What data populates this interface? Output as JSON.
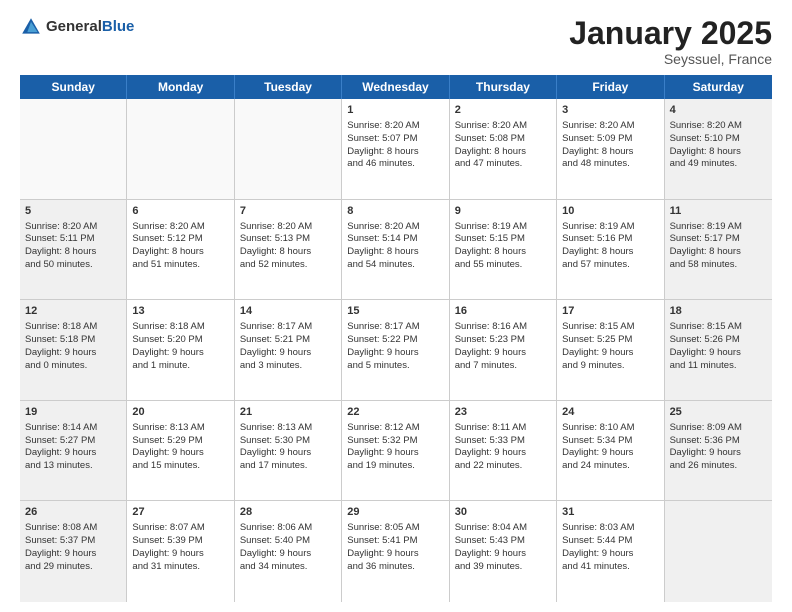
{
  "logo": {
    "general": "General",
    "blue": "Blue"
  },
  "header": {
    "month": "January 2025",
    "location": "Seyssuel, France"
  },
  "weekdays": [
    "Sunday",
    "Monday",
    "Tuesday",
    "Wednesday",
    "Thursday",
    "Friday",
    "Saturday"
  ],
  "weeks": [
    [
      {
        "day": "",
        "info": "",
        "shaded": false,
        "empty": true
      },
      {
        "day": "",
        "info": "",
        "shaded": false,
        "empty": true
      },
      {
        "day": "",
        "info": "",
        "shaded": false,
        "empty": true
      },
      {
        "day": "1",
        "info": "Sunrise: 8:20 AM\nSunset: 5:07 PM\nDaylight: 8 hours\nand 46 minutes.",
        "shaded": false,
        "empty": false
      },
      {
        "day": "2",
        "info": "Sunrise: 8:20 AM\nSunset: 5:08 PM\nDaylight: 8 hours\nand 47 minutes.",
        "shaded": false,
        "empty": false
      },
      {
        "day": "3",
        "info": "Sunrise: 8:20 AM\nSunset: 5:09 PM\nDaylight: 8 hours\nand 48 minutes.",
        "shaded": false,
        "empty": false
      },
      {
        "day": "4",
        "info": "Sunrise: 8:20 AM\nSunset: 5:10 PM\nDaylight: 8 hours\nand 49 minutes.",
        "shaded": true,
        "empty": false
      }
    ],
    [
      {
        "day": "5",
        "info": "Sunrise: 8:20 AM\nSunset: 5:11 PM\nDaylight: 8 hours\nand 50 minutes.",
        "shaded": true,
        "empty": false
      },
      {
        "day": "6",
        "info": "Sunrise: 8:20 AM\nSunset: 5:12 PM\nDaylight: 8 hours\nand 51 minutes.",
        "shaded": false,
        "empty": false
      },
      {
        "day": "7",
        "info": "Sunrise: 8:20 AM\nSunset: 5:13 PM\nDaylight: 8 hours\nand 52 minutes.",
        "shaded": false,
        "empty": false
      },
      {
        "day": "8",
        "info": "Sunrise: 8:20 AM\nSunset: 5:14 PM\nDaylight: 8 hours\nand 54 minutes.",
        "shaded": false,
        "empty": false
      },
      {
        "day": "9",
        "info": "Sunrise: 8:19 AM\nSunset: 5:15 PM\nDaylight: 8 hours\nand 55 minutes.",
        "shaded": false,
        "empty": false
      },
      {
        "day": "10",
        "info": "Sunrise: 8:19 AM\nSunset: 5:16 PM\nDaylight: 8 hours\nand 57 minutes.",
        "shaded": false,
        "empty": false
      },
      {
        "day": "11",
        "info": "Sunrise: 8:19 AM\nSunset: 5:17 PM\nDaylight: 8 hours\nand 58 minutes.",
        "shaded": true,
        "empty": false
      }
    ],
    [
      {
        "day": "12",
        "info": "Sunrise: 8:18 AM\nSunset: 5:18 PM\nDaylight: 9 hours\nand 0 minutes.",
        "shaded": true,
        "empty": false
      },
      {
        "day": "13",
        "info": "Sunrise: 8:18 AM\nSunset: 5:20 PM\nDaylight: 9 hours\nand 1 minute.",
        "shaded": false,
        "empty": false
      },
      {
        "day": "14",
        "info": "Sunrise: 8:17 AM\nSunset: 5:21 PM\nDaylight: 9 hours\nand 3 minutes.",
        "shaded": false,
        "empty": false
      },
      {
        "day": "15",
        "info": "Sunrise: 8:17 AM\nSunset: 5:22 PM\nDaylight: 9 hours\nand 5 minutes.",
        "shaded": false,
        "empty": false
      },
      {
        "day": "16",
        "info": "Sunrise: 8:16 AM\nSunset: 5:23 PM\nDaylight: 9 hours\nand 7 minutes.",
        "shaded": false,
        "empty": false
      },
      {
        "day": "17",
        "info": "Sunrise: 8:15 AM\nSunset: 5:25 PM\nDaylight: 9 hours\nand 9 minutes.",
        "shaded": false,
        "empty": false
      },
      {
        "day": "18",
        "info": "Sunrise: 8:15 AM\nSunset: 5:26 PM\nDaylight: 9 hours\nand 11 minutes.",
        "shaded": true,
        "empty": false
      }
    ],
    [
      {
        "day": "19",
        "info": "Sunrise: 8:14 AM\nSunset: 5:27 PM\nDaylight: 9 hours\nand 13 minutes.",
        "shaded": true,
        "empty": false
      },
      {
        "day": "20",
        "info": "Sunrise: 8:13 AM\nSunset: 5:29 PM\nDaylight: 9 hours\nand 15 minutes.",
        "shaded": false,
        "empty": false
      },
      {
        "day": "21",
        "info": "Sunrise: 8:13 AM\nSunset: 5:30 PM\nDaylight: 9 hours\nand 17 minutes.",
        "shaded": false,
        "empty": false
      },
      {
        "day": "22",
        "info": "Sunrise: 8:12 AM\nSunset: 5:32 PM\nDaylight: 9 hours\nand 19 minutes.",
        "shaded": false,
        "empty": false
      },
      {
        "day": "23",
        "info": "Sunrise: 8:11 AM\nSunset: 5:33 PM\nDaylight: 9 hours\nand 22 minutes.",
        "shaded": false,
        "empty": false
      },
      {
        "day": "24",
        "info": "Sunrise: 8:10 AM\nSunset: 5:34 PM\nDaylight: 9 hours\nand 24 minutes.",
        "shaded": false,
        "empty": false
      },
      {
        "day": "25",
        "info": "Sunrise: 8:09 AM\nSunset: 5:36 PM\nDaylight: 9 hours\nand 26 minutes.",
        "shaded": true,
        "empty": false
      }
    ],
    [
      {
        "day": "26",
        "info": "Sunrise: 8:08 AM\nSunset: 5:37 PM\nDaylight: 9 hours\nand 29 minutes.",
        "shaded": true,
        "empty": false
      },
      {
        "day": "27",
        "info": "Sunrise: 8:07 AM\nSunset: 5:39 PM\nDaylight: 9 hours\nand 31 minutes.",
        "shaded": false,
        "empty": false
      },
      {
        "day": "28",
        "info": "Sunrise: 8:06 AM\nSunset: 5:40 PM\nDaylight: 9 hours\nand 34 minutes.",
        "shaded": false,
        "empty": false
      },
      {
        "day": "29",
        "info": "Sunrise: 8:05 AM\nSunset: 5:41 PM\nDaylight: 9 hours\nand 36 minutes.",
        "shaded": false,
        "empty": false
      },
      {
        "day": "30",
        "info": "Sunrise: 8:04 AM\nSunset: 5:43 PM\nDaylight: 9 hours\nand 39 minutes.",
        "shaded": false,
        "empty": false
      },
      {
        "day": "31",
        "info": "Sunrise: 8:03 AM\nSunset: 5:44 PM\nDaylight: 9 hours\nand 41 minutes.",
        "shaded": false,
        "empty": false
      },
      {
        "day": "",
        "info": "",
        "shaded": true,
        "empty": true
      }
    ]
  ]
}
